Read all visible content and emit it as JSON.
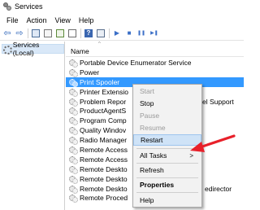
{
  "window": {
    "title": "Services"
  },
  "menubar": {
    "items": [
      "File",
      "Action",
      "View",
      "Help"
    ]
  },
  "toolbar": {
    "icons": [
      "back-arrow-icon",
      "forward-arrow-icon",
      "show-hide-tree-icon",
      "properties-icon",
      "refresh-icon",
      "export-list-icon",
      "help-icon",
      "console-tree-icon",
      "start-service-icon",
      "stop-service-icon",
      "pause-service-icon",
      "restart-service-icon"
    ],
    "glyphs": {
      "back": "⇦",
      "forward": "⇨",
      "help": "?",
      "start": "▶",
      "stop": "■",
      "pause": "❚❚",
      "restart": "▶❚"
    }
  },
  "tree": {
    "root_label": "Services (Local)"
  },
  "list": {
    "column_name": "Name",
    "sort_glyph": "^",
    "rows": [
      {
        "name": "Portable Device Enumerator Service"
      },
      {
        "name": "Power"
      },
      {
        "name": "Print Spooler",
        "selected": true
      },
      {
        "name": "Printer Extensio"
      },
      {
        "name": "Problem Repor",
        "tail": "el Support"
      },
      {
        "name": "ProductAgentS"
      },
      {
        "name": "Program Comp"
      },
      {
        "name": "Quality Windov"
      },
      {
        "name": "Radio Manager"
      },
      {
        "name": "Remote Access"
      },
      {
        "name": "Remote Access"
      },
      {
        "name": "Remote Deskto"
      },
      {
        "name": "Remote Deskto"
      },
      {
        "name": "Remote Deskto",
        "tail": "edirector"
      },
      {
        "name": "Remote Proced"
      }
    ]
  },
  "context_menu": {
    "start": "Start",
    "stop": "Stop",
    "pause": "Pause",
    "resume": "Resume",
    "restart": "Restart",
    "all_tasks": "All Tasks",
    "all_tasks_arrow": ">",
    "refresh": "Refresh",
    "properties": "Properties",
    "help": "Help"
  },
  "colors": {
    "selection": "#3399ff",
    "menu_highlight": "#cfe3f7",
    "arrow": "#e8202a"
  }
}
